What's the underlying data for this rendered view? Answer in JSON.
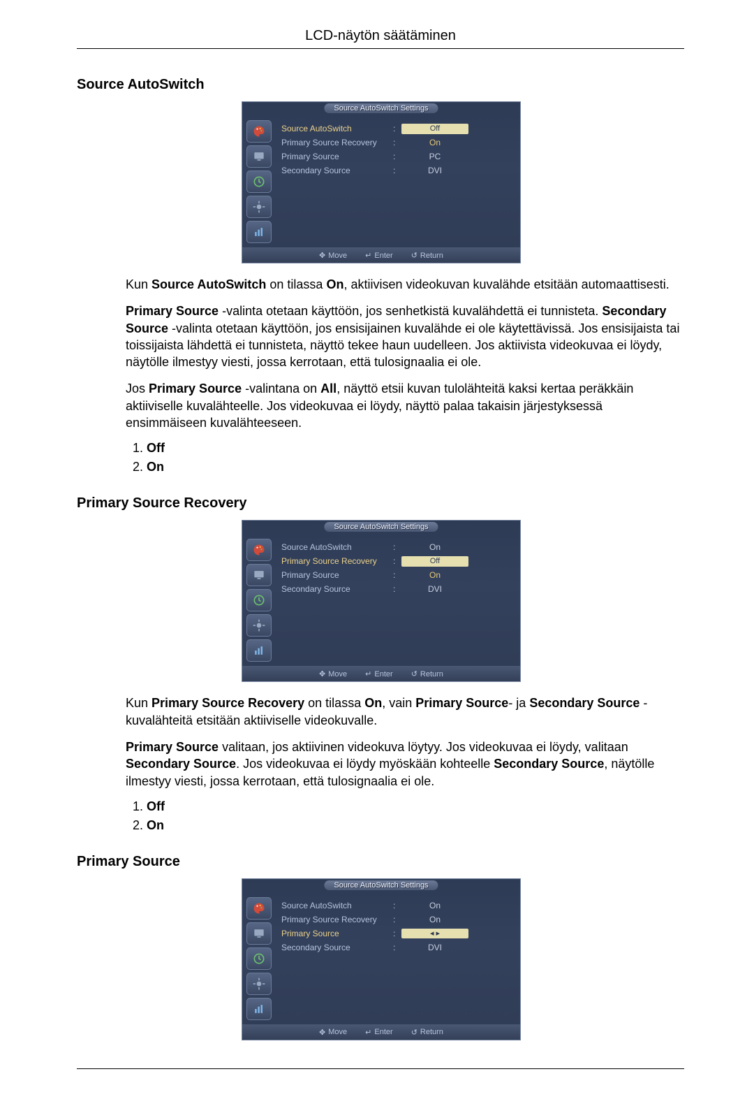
{
  "header": {
    "title": "LCD-näytön säätäminen"
  },
  "sections": {
    "s1": {
      "heading": "Source AutoSwitch",
      "para1_before_b1": "Kun ",
      "para1_b1": "Source AutoSwitch",
      "para1_mid1": " on tilassa ",
      "para1_b2": "On",
      "para1_after": ", aktiivisen videokuvan kuvalähde etsitään automaattisesti.",
      "para2_b1": "Primary Source",
      "para2_mid1": " -valinta otetaan käyttöön, jos senhetkistä kuvalähdettä ei tunnisteta. ",
      "para2_b2": "Secondary Source",
      "para2_after": " -valinta otetaan käyttöön, jos ensisijainen kuvalähde ei ole käytettävissä. Jos ensisijaista tai toissijaista lähdettä ei tunnisteta, näyttö tekee haun uudelleen. Jos aktiivista videokuvaa ei löydy, näytölle ilmestyy viesti, jossa kerrotaan, että tulosignaalia ei ole.",
      "para3_pre": "Jos ",
      "para3_b1": "Primary Source",
      "para3_mid": " -valintana on ",
      "para3_b2": "All",
      "para3_after": ", näyttö etsii kuvan tulolähteitä kaksi kertaa peräkkäin aktiiviselle kuvalähteelle. Jos videokuvaa ei löydy, näyttö palaa takaisin järjestyksessä ensimmäiseen kuvalähteeseen.",
      "list": {
        "n1": "1.",
        "v1": "Off",
        "n2": "2.",
        "v2": "On"
      }
    },
    "s2": {
      "heading": "Primary Source Recovery",
      "para1_pre": "Kun ",
      "para1_b1": "Primary Source Recovery",
      "para1_mid1": " on tilassa ",
      "para1_b2": "On",
      "para1_mid2": ", vain ",
      "para1_b3": "Primary Source",
      "para1_mid3": "- ja ",
      "para1_b4": "Secondary Source",
      "para1_after": " -kuvalähteitä etsitään aktiiviselle videokuvalle.",
      "para2_b1": "Primary Source",
      "para2_mid1": " valitaan, jos aktiivinen videokuva löytyy. Jos videokuvaa ei löydy, valitaan ",
      "para2_b2": "Secondary Source",
      "para2_mid2": ". Jos videokuvaa ei löydy myöskään kohteelle ",
      "para2_b3": "Secondary Source",
      "para2_after": ", näytölle ilmestyy viesti, jossa kerrotaan, että tulosignaalia ei ole.",
      "list": {
        "n1": "1.",
        "v1": "Off",
        "n2": "2.",
        "v2": "On"
      }
    },
    "s3": {
      "heading": "Primary Source"
    }
  },
  "osd": {
    "title": "Source AutoSwitch Settings",
    "labels": {
      "l1": "Source AutoSwitch",
      "l2": "Primary Source Recovery",
      "l3": "Primary Source",
      "l4": "Secondary Source"
    },
    "nav": {
      "move": "Move",
      "enter": "Enter",
      "ret": "Return"
    },
    "v_on": "On",
    "v_off": "Off",
    "v_pc": "PC",
    "v_dvi": "DVI",
    "shot1": {
      "r1": "Off",
      "r2": "On",
      "r3": "PC",
      "r4": "DVI"
    },
    "shot2": {
      "r1": "On",
      "r2": "Off",
      "r3": "On",
      "r4": "DVI"
    },
    "shot3": {
      "r1": "On",
      "r2": "On",
      "r3": "",
      "r4": "DVI"
    }
  }
}
